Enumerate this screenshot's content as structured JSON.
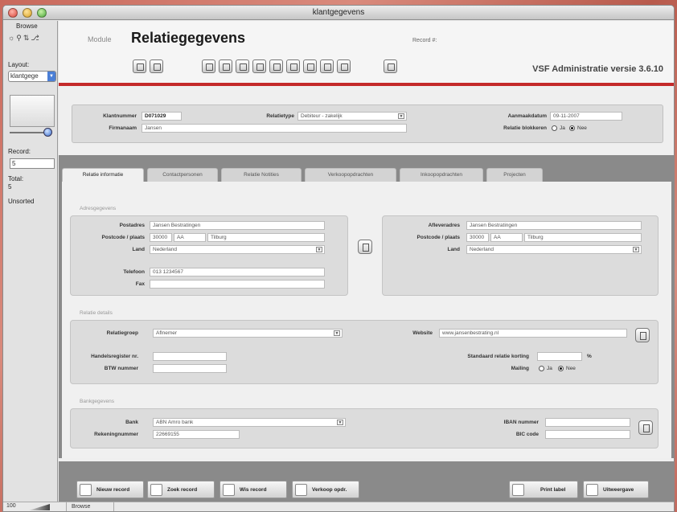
{
  "window": {
    "title": "klantgegevens"
  },
  "statusbar": {
    "zoom": "100",
    "mode": "Browse"
  },
  "sidebar": {
    "mode": "Browse",
    "layout_label": "Layout:",
    "layout_value": "klantgege",
    "record_label": "Record:",
    "record_value": "5",
    "total_label": "Total:",
    "total_value": "5",
    "sort_state": "Unsorted"
  },
  "header": {
    "module_label": "Module",
    "title": "Relatiegegevens",
    "record_label": "Record #:",
    "version": "VSF Administratie versie 3.6.10"
  },
  "info": {
    "klantnummer_label": "Klantnummer",
    "klantnummer": "D071029",
    "firmanaam_label": "Firmanaam",
    "firmanaam": "Jansen",
    "relatietype_label": "Relatietype",
    "relatietype": "Debiteur - zakelijk",
    "aanmaakdatum_label": "Aanmaakdatum",
    "aanmaakdatum": "09-11-2007",
    "blokkeren_label": "Relatie blokkeren",
    "ja": "Ja",
    "nee": "Nee"
  },
  "tabs": [
    "Relatie informatie",
    "Contactpersonen",
    "Relatie Notities",
    "Verkoopopdrachten",
    "Inkoopopdrachten",
    "Projecten"
  ],
  "adres": {
    "section_label": "Adresgegevens",
    "postadres_label": "Postadres",
    "postadres": "Jansen Bestratingen",
    "postcode_label": "Postcode / plaats",
    "postcode": "30000",
    "postcode_letters": "AA",
    "plaats": "Tilburg",
    "land_label": "Land",
    "land": "Nederland",
    "telefoon_label": "Telefoon",
    "telefoon": "013 1234567",
    "fax_label": "Fax",
    "fax": "",
    "afleveradres_label": "Afleveradres",
    "afleveradres": "Jansen Bestratingen",
    "a_postcode_label": "Postcode / plaats",
    "a_postcode": "30000",
    "a_postcode_letters": "AA",
    "a_plaats": "Tilburg",
    "a_land_label": "Land",
    "a_land": "Nederland"
  },
  "details": {
    "section_label": "Relatie details",
    "relatiegroep_label": "Relatiegroep",
    "relatiegroep": "Aflnemer",
    "website_label": "Website",
    "website": "www.jansenbestrating.nl",
    "kvk_label": "Handelsregister nr.",
    "kvk": "",
    "btw_label": "BTW nummer",
    "btw": "",
    "korting_label": "Standaard relatie korting",
    "korting": "",
    "pct": "%",
    "mailing_label": "Mailing",
    "ja": "Ja",
    "nee": "Nee"
  },
  "bank": {
    "section_label": "Bankgegevens",
    "bank_label": "Bank",
    "bank": "ABN Amro bank",
    "rekening_label": "Rekeningnummer",
    "rekening": "22669155",
    "iban_label": "IBAN nummer",
    "iban": "",
    "bic_label": "BIC code",
    "bic": ""
  },
  "footer": {
    "nieuw": "Nieuw record",
    "zoek": "Zoek record",
    "wis": "Wis record",
    "verkoop": "Verkoop opdr.",
    "print": "Print label",
    "uitweergave": "Uitweergave"
  }
}
